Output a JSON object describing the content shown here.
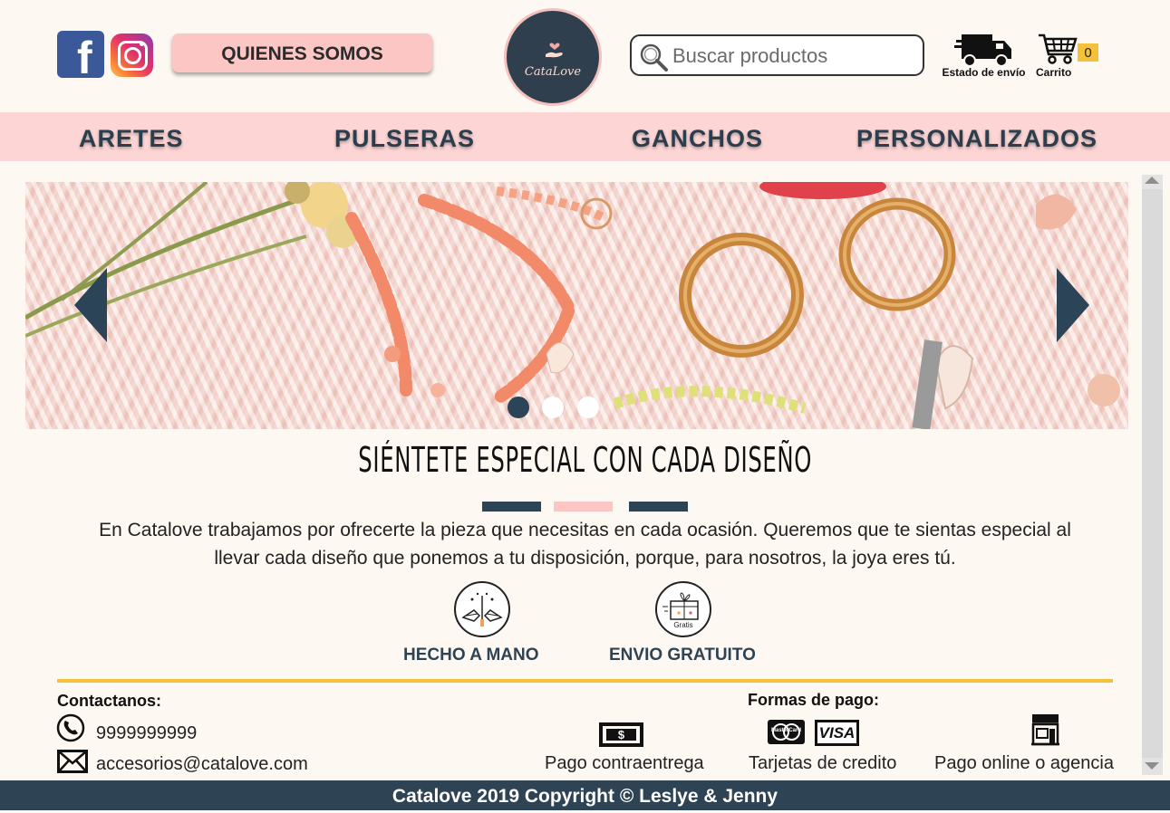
{
  "header": {
    "facebook_icon": "facebook-icon",
    "instagram_icon": "instagram-icon",
    "about_label": "QUIENES SOMOS",
    "logo_text": "CataLove",
    "search_placeholder": "Buscar productos",
    "shipping_label": "Estado de envío",
    "cart_label": "Carrito",
    "cart_count": "0"
  },
  "nav": {
    "items": [
      "ARETES",
      "PULSERAS",
      "GANCHOS",
      "PERSONALIZADOS"
    ]
  },
  "slider": {
    "total_slides": 3,
    "active_slide": 1
  },
  "main": {
    "headline": "SIÉNTETE ESPECIAL CON CADA DISEÑO",
    "description_line1": "En Catalove trabajamos por ofrecerte la pieza que necesitas en cada ocasión. Queremos que te sientas especial al",
    "description_line2": "llevar cada diseño que ponemos a tu disposición, porque, para nosotros, la joya eres tú.",
    "features": [
      {
        "label": "HECHO A MANO",
        "icon": "handmade-icon"
      },
      {
        "label": "ENVIO GRATUITO",
        "icon": "free-shipping-icon",
        "icon_text": "Gratis"
      }
    ]
  },
  "footer": {
    "contact_title": "Contactanos:",
    "phone": "9999999999",
    "email": "accesorios@catalove.com",
    "payment_title": "Formas de pago:",
    "payments": [
      "Pago contraentrega",
      "Tarjetas de credito",
      "Pago online o agencia"
    ],
    "card_labels": [
      "MasterCard",
      "VISA"
    ],
    "copyright": "Catalove 2019 Copyright  © Leslye & Jenny"
  },
  "colors": {
    "background": "#fdf8f1",
    "nav_pink": "#fcd5d4",
    "navy": "#2e4353",
    "accent_yellow": "#f4bf3b",
    "button_pink": "#fbc6c4"
  }
}
